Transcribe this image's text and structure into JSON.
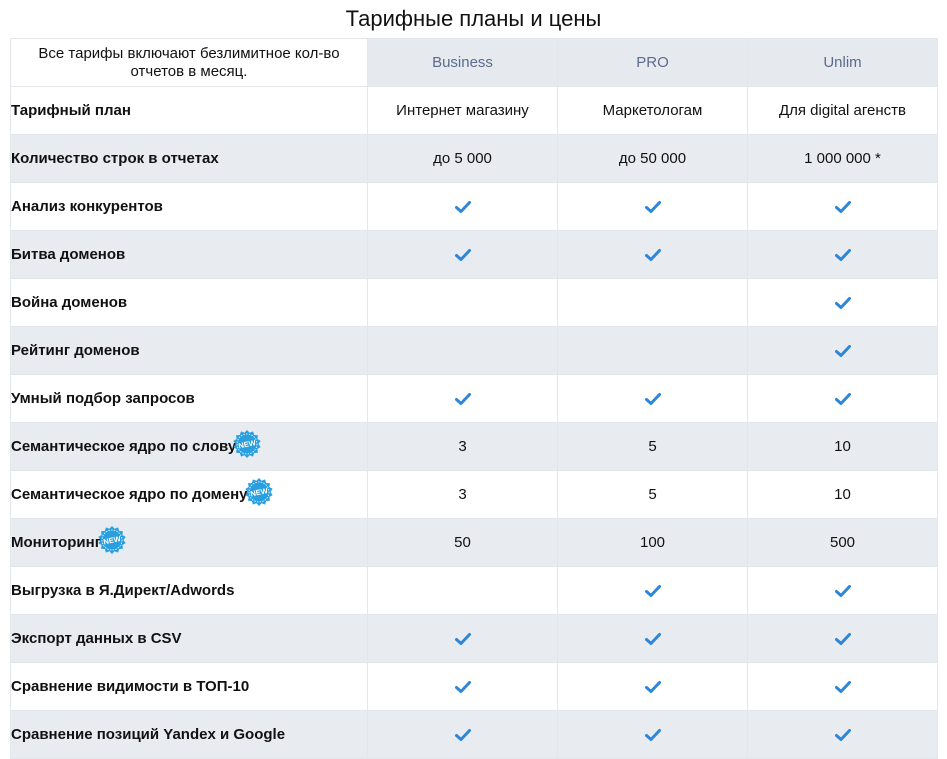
{
  "page": {
    "title": "Тарифные планы и цены"
  },
  "header": {
    "note": "Все тарифы включают безлимитное кол-во отчетов в месяц.",
    "plans": [
      "Business",
      "PRO",
      "Unlim"
    ]
  },
  "colors": {
    "check": "#2d86d6",
    "plan_header_bg": "#e6eaef",
    "plan_header_text": "#5a6b8c",
    "badge": "#2a9fe0"
  },
  "badge_label": "NEW",
  "rows": [
    {
      "feature": "Тарифный план",
      "new": false,
      "values": [
        "Интернет магазину",
        "Маркетологам",
        "Для digital агенств"
      ]
    },
    {
      "feature": "Количество строк в отчетах",
      "new": false,
      "values": [
        "до 5 000",
        "до 50 000",
        "1 000 000 *"
      ]
    },
    {
      "feature": "Анализ конкурентов",
      "new": false,
      "values": [
        "check-icon",
        "check-icon",
        "check-icon"
      ]
    },
    {
      "feature": "Битва доменов",
      "new": false,
      "values": [
        "check-icon",
        "check-icon",
        "check-icon"
      ]
    },
    {
      "feature": "Война доменов",
      "new": false,
      "values": [
        "",
        "",
        "check-icon"
      ]
    },
    {
      "feature": "Рейтинг доменов",
      "new": false,
      "values": [
        "",
        "",
        "check-icon"
      ]
    },
    {
      "feature": "Умный подбор запросов",
      "new": false,
      "values": [
        "check-icon",
        "check-icon",
        "check-icon"
      ]
    },
    {
      "feature": "Семантическое ядро по слову",
      "new": true,
      "values": [
        "3",
        "5",
        "10"
      ]
    },
    {
      "feature": "Семантическое ядро по домену",
      "new": true,
      "values": [
        "3",
        "5",
        "10"
      ]
    },
    {
      "feature": "Мониторинг",
      "new": true,
      "values": [
        "50",
        "100",
        "500"
      ]
    },
    {
      "feature": "Выгрузка в Я.Директ/Adwords",
      "new": false,
      "values": [
        "",
        "check-icon",
        "check-icon"
      ]
    },
    {
      "feature": "Экспорт данных в CSV",
      "new": false,
      "values": [
        "check-icon",
        "check-icon",
        "check-icon"
      ]
    },
    {
      "feature": "Сравнение видимости в ТОП-10",
      "new": false,
      "values": [
        "check-icon",
        "check-icon",
        "check-icon"
      ]
    },
    {
      "feature": "Сравнение позиций Yandex и Google",
      "new": false,
      "values": [
        "check-icon",
        "check-icon",
        "check-icon"
      ]
    }
  ]
}
